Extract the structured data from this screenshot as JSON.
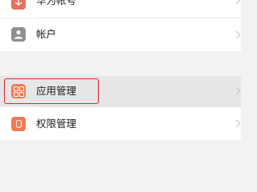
{
  "settings_list": {
    "items": [
      {
        "label": "华为帐号",
        "icon": "huawei-account-icon",
        "icon_color": "#e8705a"
      },
      {
        "label": "帐户",
        "icon": "user-account-icon",
        "icon_color": "#8f8f95"
      },
      {
        "label": "应用管理",
        "icon": "app-grid-icon",
        "icon_color": "#f07a54"
      },
      {
        "label": "权限管理",
        "icon": "shield-icon",
        "icon_color": "#f07a54"
      }
    ]
  },
  "highlight_color": "#d9262b"
}
